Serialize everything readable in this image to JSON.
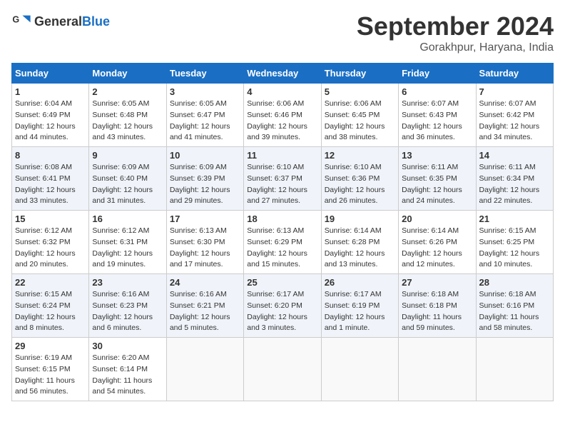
{
  "logo": {
    "text_general": "General",
    "text_blue": "Blue"
  },
  "title": {
    "month_year": "September 2024",
    "location": "Gorakhpur, Haryana, India"
  },
  "headers": [
    "Sunday",
    "Monday",
    "Tuesday",
    "Wednesday",
    "Thursday",
    "Friday",
    "Saturday"
  ],
  "weeks": [
    [
      {
        "day": "1",
        "sunrise": "6:04 AM",
        "sunset": "6:49 PM",
        "daylight": "12 hours and 44 minutes."
      },
      {
        "day": "2",
        "sunrise": "6:05 AM",
        "sunset": "6:48 PM",
        "daylight": "12 hours and 43 minutes."
      },
      {
        "day": "3",
        "sunrise": "6:05 AM",
        "sunset": "6:47 PM",
        "daylight": "12 hours and 41 minutes."
      },
      {
        "day": "4",
        "sunrise": "6:06 AM",
        "sunset": "6:46 PM",
        "daylight": "12 hours and 39 minutes."
      },
      {
        "day": "5",
        "sunrise": "6:06 AM",
        "sunset": "6:45 PM",
        "daylight": "12 hours and 38 minutes."
      },
      {
        "day": "6",
        "sunrise": "6:07 AM",
        "sunset": "6:43 PM",
        "daylight": "12 hours and 36 minutes."
      },
      {
        "day": "7",
        "sunrise": "6:07 AM",
        "sunset": "6:42 PM",
        "daylight": "12 hours and 34 minutes."
      }
    ],
    [
      {
        "day": "8",
        "sunrise": "6:08 AM",
        "sunset": "6:41 PM",
        "daylight": "12 hours and 33 minutes."
      },
      {
        "day": "9",
        "sunrise": "6:09 AM",
        "sunset": "6:40 PM",
        "daylight": "12 hours and 31 minutes."
      },
      {
        "day": "10",
        "sunrise": "6:09 AM",
        "sunset": "6:39 PM",
        "daylight": "12 hours and 29 minutes."
      },
      {
        "day": "11",
        "sunrise": "6:10 AM",
        "sunset": "6:37 PM",
        "daylight": "12 hours and 27 minutes."
      },
      {
        "day": "12",
        "sunrise": "6:10 AM",
        "sunset": "6:36 PM",
        "daylight": "12 hours and 26 minutes."
      },
      {
        "day": "13",
        "sunrise": "6:11 AM",
        "sunset": "6:35 PM",
        "daylight": "12 hours and 24 minutes."
      },
      {
        "day": "14",
        "sunrise": "6:11 AM",
        "sunset": "6:34 PM",
        "daylight": "12 hours and 22 minutes."
      }
    ],
    [
      {
        "day": "15",
        "sunrise": "6:12 AM",
        "sunset": "6:32 PM",
        "daylight": "12 hours and 20 minutes."
      },
      {
        "day": "16",
        "sunrise": "6:12 AM",
        "sunset": "6:31 PM",
        "daylight": "12 hours and 19 minutes."
      },
      {
        "day": "17",
        "sunrise": "6:13 AM",
        "sunset": "6:30 PM",
        "daylight": "12 hours and 17 minutes."
      },
      {
        "day": "18",
        "sunrise": "6:13 AM",
        "sunset": "6:29 PM",
        "daylight": "12 hours and 15 minutes."
      },
      {
        "day": "19",
        "sunrise": "6:14 AM",
        "sunset": "6:28 PM",
        "daylight": "12 hours and 13 minutes."
      },
      {
        "day": "20",
        "sunrise": "6:14 AM",
        "sunset": "6:26 PM",
        "daylight": "12 hours and 12 minutes."
      },
      {
        "day": "21",
        "sunrise": "6:15 AM",
        "sunset": "6:25 PM",
        "daylight": "12 hours and 10 minutes."
      }
    ],
    [
      {
        "day": "22",
        "sunrise": "6:15 AM",
        "sunset": "6:24 PM",
        "daylight": "12 hours and 8 minutes."
      },
      {
        "day": "23",
        "sunrise": "6:16 AM",
        "sunset": "6:23 PM",
        "daylight": "12 hours and 6 minutes."
      },
      {
        "day": "24",
        "sunrise": "6:16 AM",
        "sunset": "6:21 PM",
        "daylight": "12 hours and 5 minutes."
      },
      {
        "day": "25",
        "sunrise": "6:17 AM",
        "sunset": "6:20 PM",
        "daylight": "12 hours and 3 minutes."
      },
      {
        "day": "26",
        "sunrise": "6:17 AM",
        "sunset": "6:19 PM",
        "daylight": "12 hours and 1 minute."
      },
      {
        "day": "27",
        "sunrise": "6:18 AM",
        "sunset": "6:18 PM",
        "daylight": "11 hours and 59 minutes."
      },
      {
        "day": "28",
        "sunrise": "6:18 AM",
        "sunset": "6:16 PM",
        "daylight": "11 hours and 58 minutes."
      }
    ],
    [
      {
        "day": "29",
        "sunrise": "6:19 AM",
        "sunset": "6:15 PM",
        "daylight": "11 hours and 56 minutes."
      },
      {
        "day": "30",
        "sunrise": "6:20 AM",
        "sunset": "6:14 PM",
        "daylight": "11 hours and 54 minutes."
      },
      null,
      null,
      null,
      null,
      null
    ]
  ]
}
